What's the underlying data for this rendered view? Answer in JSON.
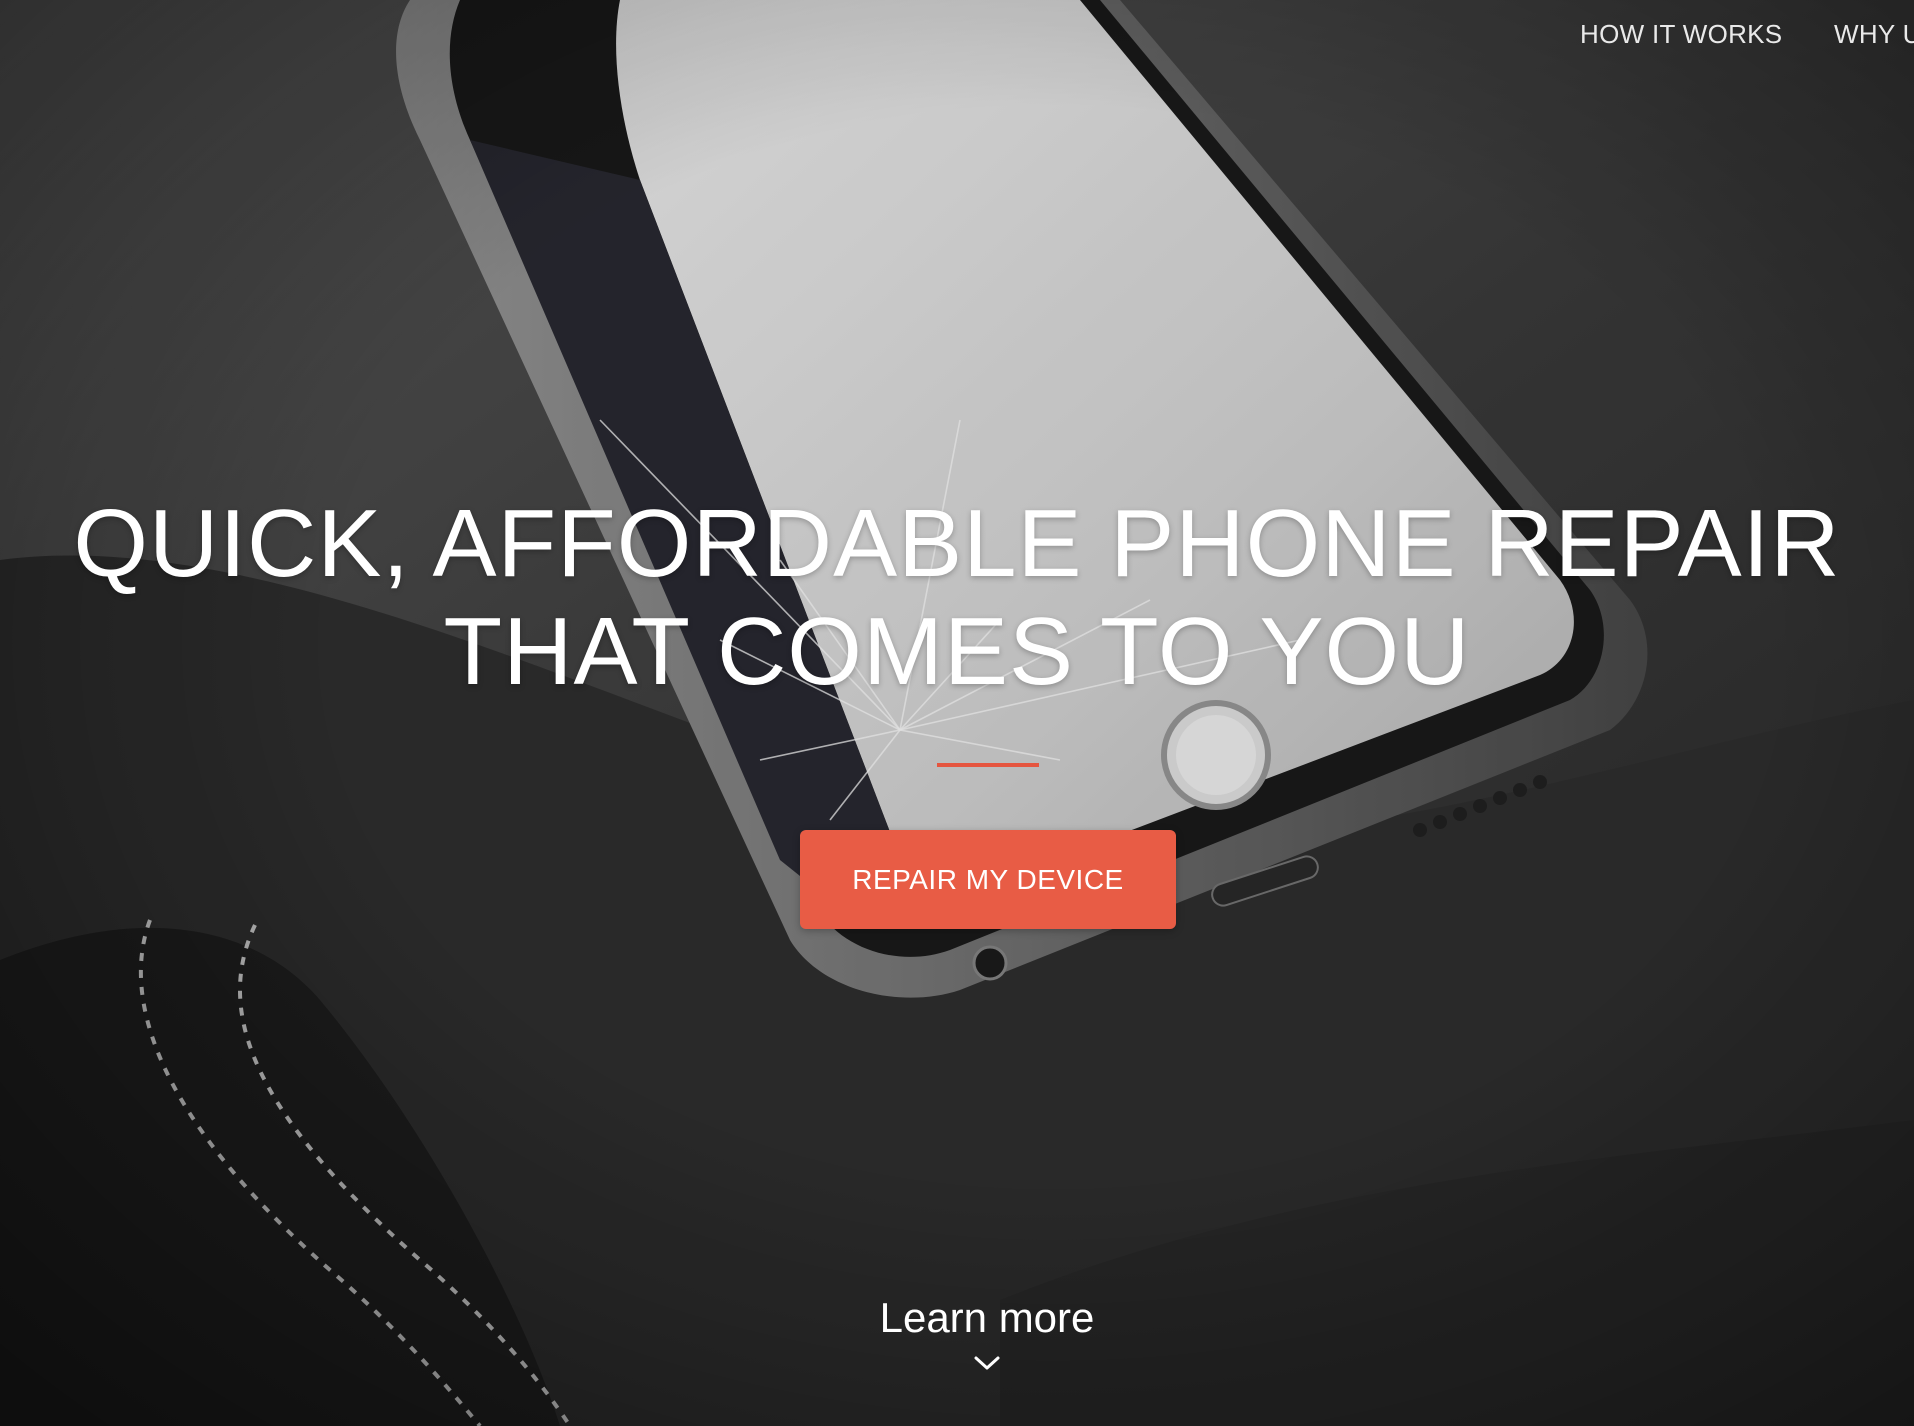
{
  "nav": {
    "items": [
      {
        "label": "HOW IT WORKS"
      },
      {
        "label": "WHY U"
      }
    ]
  },
  "hero": {
    "headline_line1": "QUICK, AFFORDABLE PHONE REPAIR",
    "headline_line2": "THAT COMES TO YOU",
    "cta_label": "REPAIR MY DEVICE",
    "learn_more_label": "Learn more",
    "learn_more_icon": "chevron-down-icon"
  },
  "colors": {
    "accent": "#e85c45",
    "text": "#ffffff",
    "background": "#3a3a3a"
  }
}
